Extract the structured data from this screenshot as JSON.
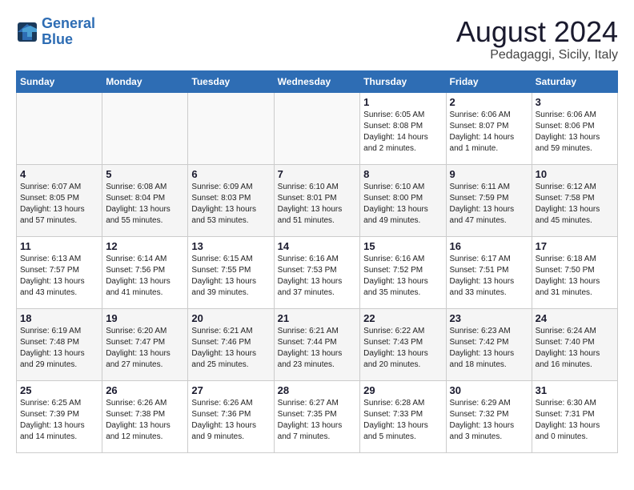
{
  "logo": {
    "line1": "General",
    "line2": "Blue"
  },
  "title": "August 2024",
  "subtitle": "Pedagaggi, Sicily, Italy",
  "days_of_week": [
    "Sunday",
    "Monday",
    "Tuesday",
    "Wednesday",
    "Thursday",
    "Friday",
    "Saturday"
  ],
  "weeks": [
    [
      {
        "day": "",
        "info": ""
      },
      {
        "day": "",
        "info": ""
      },
      {
        "day": "",
        "info": ""
      },
      {
        "day": "",
        "info": ""
      },
      {
        "day": "1",
        "info": "Sunrise: 6:05 AM\nSunset: 8:08 PM\nDaylight: 14 hours\nand 2 minutes."
      },
      {
        "day": "2",
        "info": "Sunrise: 6:06 AM\nSunset: 8:07 PM\nDaylight: 14 hours\nand 1 minute."
      },
      {
        "day": "3",
        "info": "Sunrise: 6:06 AM\nSunset: 8:06 PM\nDaylight: 13 hours\nand 59 minutes."
      }
    ],
    [
      {
        "day": "4",
        "info": "Sunrise: 6:07 AM\nSunset: 8:05 PM\nDaylight: 13 hours\nand 57 minutes."
      },
      {
        "day": "5",
        "info": "Sunrise: 6:08 AM\nSunset: 8:04 PM\nDaylight: 13 hours\nand 55 minutes."
      },
      {
        "day": "6",
        "info": "Sunrise: 6:09 AM\nSunset: 8:03 PM\nDaylight: 13 hours\nand 53 minutes."
      },
      {
        "day": "7",
        "info": "Sunrise: 6:10 AM\nSunset: 8:01 PM\nDaylight: 13 hours\nand 51 minutes."
      },
      {
        "day": "8",
        "info": "Sunrise: 6:10 AM\nSunset: 8:00 PM\nDaylight: 13 hours\nand 49 minutes."
      },
      {
        "day": "9",
        "info": "Sunrise: 6:11 AM\nSunset: 7:59 PM\nDaylight: 13 hours\nand 47 minutes."
      },
      {
        "day": "10",
        "info": "Sunrise: 6:12 AM\nSunset: 7:58 PM\nDaylight: 13 hours\nand 45 minutes."
      }
    ],
    [
      {
        "day": "11",
        "info": "Sunrise: 6:13 AM\nSunset: 7:57 PM\nDaylight: 13 hours\nand 43 minutes."
      },
      {
        "day": "12",
        "info": "Sunrise: 6:14 AM\nSunset: 7:56 PM\nDaylight: 13 hours\nand 41 minutes."
      },
      {
        "day": "13",
        "info": "Sunrise: 6:15 AM\nSunset: 7:55 PM\nDaylight: 13 hours\nand 39 minutes."
      },
      {
        "day": "14",
        "info": "Sunrise: 6:16 AM\nSunset: 7:53 PM\nDaylight: 13 hours\nand 37 minutes."
      },
      {
        "day": "15",
        "info": "Sunrise: 6:16 AM\nSunset: 7:52 PM\nDaylight: 13 hours\nand 35 minutes."
      },
      {
        "day": "16",
        "info": "Sunrise: 6:17 AM\nSunset: 7:51 PM\nDaylight: 13 hours\nand 33 minutes."
      },
      {
        "day": "17",
        "info": "Sunrise: 6:18 AM\nSunset: 7:50 PM\nDaylight: 13 hours\nand 31 minutes."
      }
    ],
    [
      {
        "day": "18",
        "info": "Sunrise: 6:19 AM\nSunset: 7:48 PM\nDaylight: 13 hours\nand 29 minutes."
      },
      {
        "day": "19",
        "info": "Sunrise: 6:20 AM\nSunset: 7:47 PM\nDaylight: 13 hours\nand 27 minutes."
      },
      {
        "day": "20",
        "info": "Sunrise: 6:21 AM\nSunset: 7:46 PM\nDaylight: 13 hours\nand 25 minutes."
      },
      {
        "day": "21",
        "info": "Sunrise: 6:21 AM\nSunset: 7:44 PM\nDaylight: 13 hours\nand 23 minutes."
      },
      {
        "day": "22",
        "info": "Sunrise: 6:22 AM\nSunset: 7:43 PM\nDaylight: 13 hours\nand 20 minutes."
      },
      {
        "day": "23",
        "info": "Sunrise: 6:23 AM\nSunset: 7:42 PM\nDaylight: 13 hours\nand 18 minutes."
      },
      {
        "day": "24",
        "info": "Sunrise: 6:24 AM\nSunset: 7:40 PM\nDaylight: 13 hours\nand 16 minutes."
      }
    ],
    [
      {
        "day": "25",
        "info": "Sunrise: 6:25 AM\nSunset: 7:39 PM\nDaylight: 13 hours\nand 14 minutes."
      },
      {
        "day": "26",
        "info": "Sunrise: 6:26 AM\nSunset: 7:38 PM\nDaylight: 13 hours\nand 12 minutes."
      },
      {
        "day": "27",
        "info": "Sunrise: 6:26 AM\nSunset: 7:36 PM\nDaylight: 13 hours\nand 9 minutes."
      },
      {
        "day": "28",
        "info": "Sunrise: 6:27 AM\nSunset: 7:35 PM\nDaylight: 13 hours\nand 7 minutes."
      },
      {
        "day": "29",
        "info": "Sunrise: 6:28 AM\nSunset: 7:33 PM\nDaylight: 13 hours\nand 5 minutes."
      },
      {
        "day": "30",
        "info": "Sunrise: 6:29 AM\nSunset: 7:32 PM\nDaylight: 13 hours\nand 3 minutes."
      },
      {
        "day": "31",
        "info": "Sunrise: 6:30 AM\nSunset: 7:31 PM\nDaylight: 13 hours\nand 0 minutes."
      }
    ]
  ]
}
